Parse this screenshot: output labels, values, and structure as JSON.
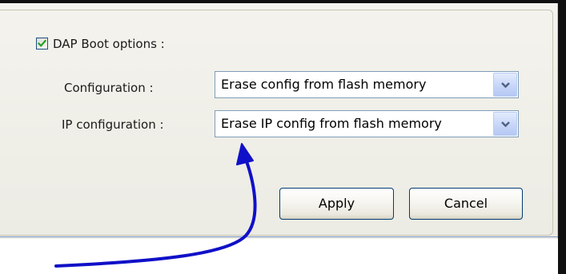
{
  "dap_boot": {
    "checkbox_label": "DAP Boot options :",
    "checked": true
  },
  "configuration": {
    "label": "Configuration :",
    "value": "Erase config from flash memory"
  },
  "ip_configuration": {
    "label": "IP configuration :",
    "value": "Erase IP config from flash memory"
  },
  "buttons": {
    "apply": "Apply",
    "cancel": "Cancel"
  },
  "icons": {
    "checkbox": "check-icon",
    "dropdown": "chevron-down-icon"
  },
  "colors": {
    "panel_background": "#efeee7",
    "check_green": "#21a121",
    "combo_border": "#7f9db9",
    "button_border": "#003c74",
    "annotation_arrow": "#1010c8",
    "frame": "#101010"
  }
}
